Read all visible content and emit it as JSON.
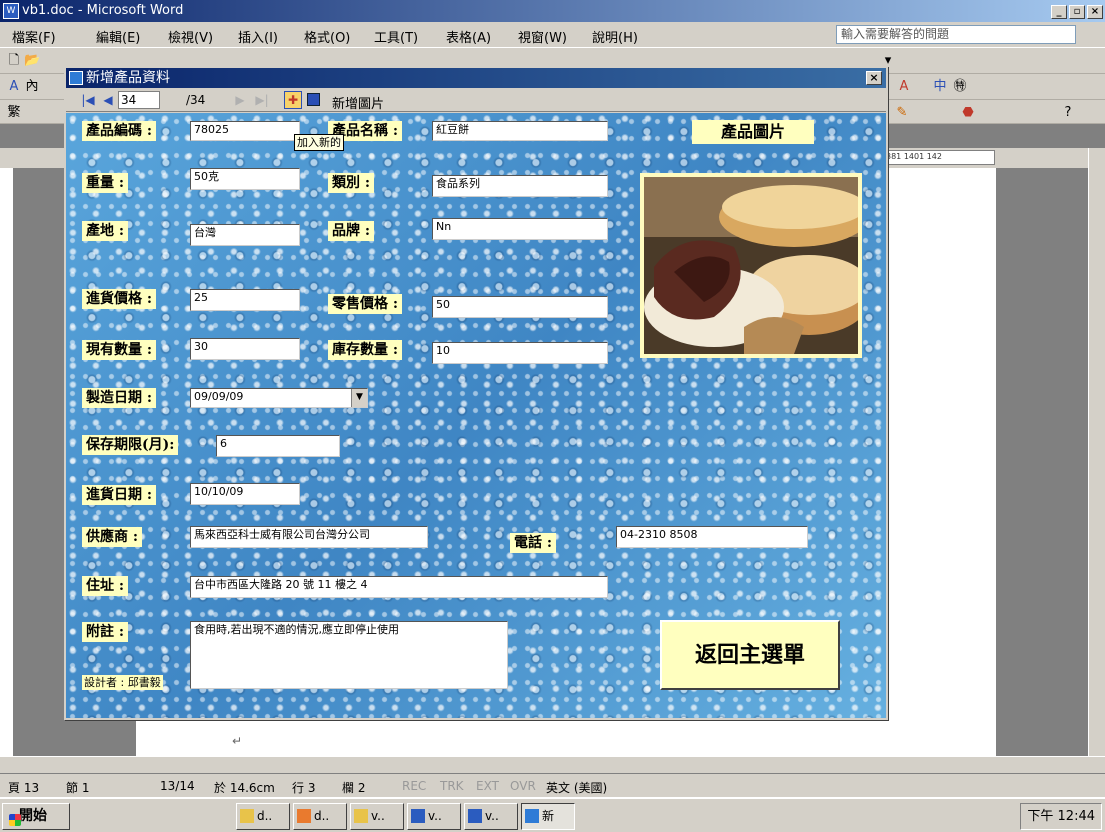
{
  "word": {
    "title": "vb1.doc - Microsoft Word",
    "menus": [
      "檔案(F)",
      "編輯(E)",
      "檢視(V)",
      "插入(I)",
      "格式(O)",
      "工具(T)",
      "表格(A)",
      "視窗(W)",
      "說明(H)"
    ],
    "ask_placeholder": "輸入需要解答的問題",
    "ruler_marks": "381 1401 142"
  },
  "form": {
    "title": "新增產品資料",
    "record_current": "34",
    "record_total": "/34",
    "add_image_label": "新增圖片",
    "tooltip": "加入新的",
    "image_label": "產品圖片",
    "back_button": "返回主選單",
    "designer": "設計者 : 邱書毅",
    "fields": {
      "code": {
        "label": "產品編碼 :",
        "value": "78025"
      },
      "name": {
        "label": "產品名稱 :",
        "value": "紅豆餅"
      },
      "weight": {
        "label": "重量 :",
        "value": "50克"
      },
      "category": {
        "label": "類別 :",
        "value": "食品系列"
      },
      "origin": {
        "label": "產地 :",
        "value": "台灣"
      },
      "brand": {
        "label": "品牌 :",
        "value": "Nn"
      },
      "cost": {
        "label": "進貨價格 :",
        "value": "25"
      },
      "retail": {
        "label": "零售價格 :",
        "value": "50"
      },
      "current_qty": {
        "label": "現有數量 :",
        "value": "30"
      },
      "stock_qty": {
        "label": "庫存數量 :",
        "value": "10"
      },
      "mfg_date": {
        "label": "製造日期 :",
        "value": "09/09/09"
      },
      "shelf_life": {
        "label": "保存期限(月):",
        "value": "6"
      },
      "purchase_date": {
        "label": "進貨日期 :",
        "value": "10/10/09"
      },
      "supplier": {
        "label": "供應商 :",
        "value": "馬來西亞科士威有限公司台灣分公司"
      },
      "phone": {
        "label": "電話 :",
        "value": "04-2310 8508"
      },
      "address": {
        "label": "住址 :",
        "value": "台中市西區大隆路 20 號 11 樓之 4"
      },
      "notes": {
        "label": "附註 :",
        "value": "食用時,若出現不適的情況,應立即停止使用"
      }
    }
  },
  "status": {
    "page": "頁 13",
    "section": "節 1",
    "pages": "13/14",
    "at": "於 14.6cm",
    "line": "行 3",
    "col": "欄 2",
    "rec": "REC",
    "trk": "TRK",
    "ext": "EXT",
    "ovr": "OVR",
    "lang": "英文 (美國)"
  },
  "taskbar": {
    "start": "開始",
    "tasks": [
      "d..",
      "d..",
      "v..",
      "v..",
      "v..",
      "新"
    ],
    "clock": "下午 12:44"
  }
}
